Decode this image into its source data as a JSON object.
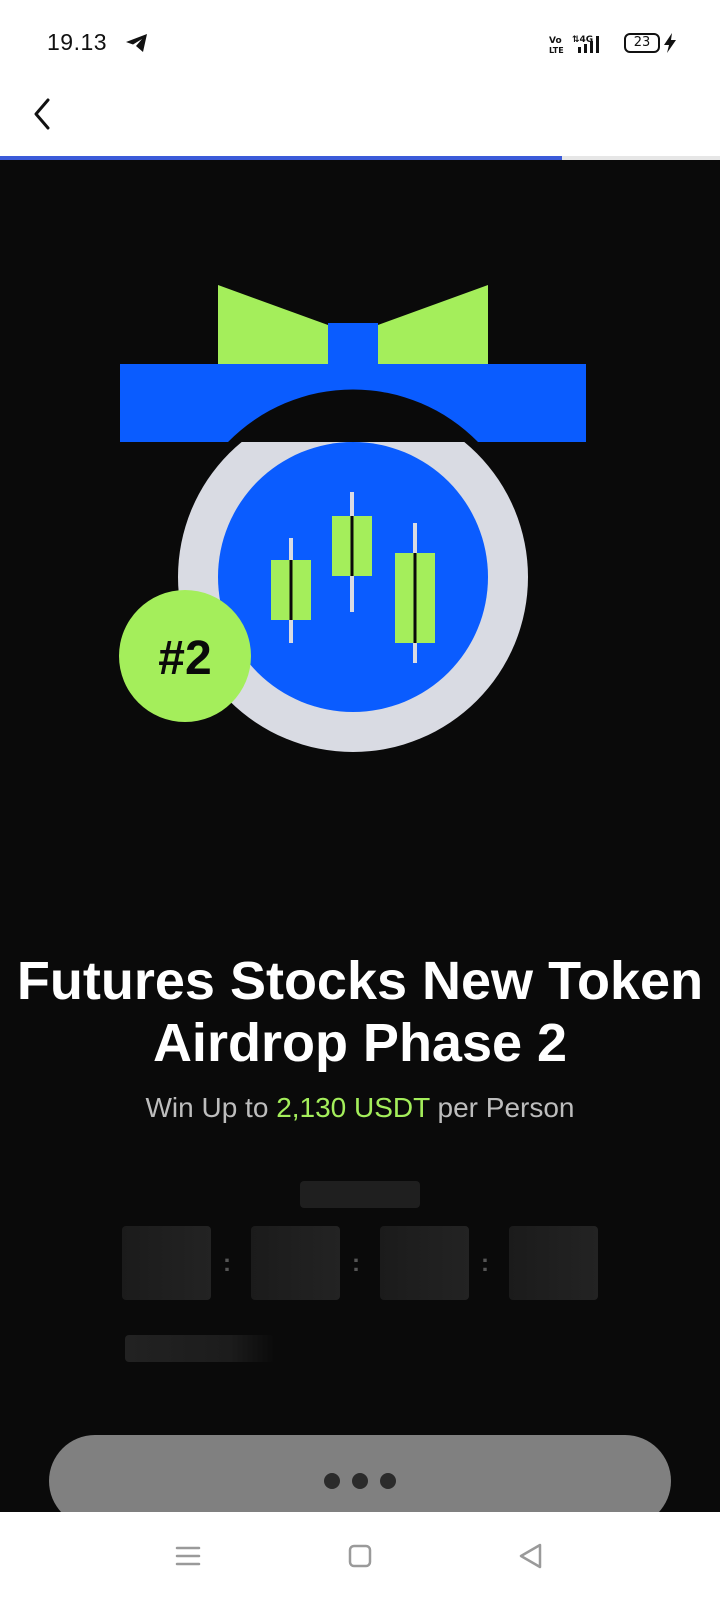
{
  "status_bar": {
    "time": "19.13",
    "battery_level": "23",
    "icons": [
      "telegram-icon",
      "volte-icon",
      "signal-4g-icon",
      "battery-icon",
      "charging-bolt-icon"
    ]
  },
  "header": {
    "back_icon": "chevron-left-icon",
    "progress_fraction": 0.78
  },
  "hero": {
    "badge_text": "#2",
    "colors": {
      "ribbon_blue": "#0a5cff",
      "bow_green": "#a4ee5b",
      "ring_gray": "#d9dbe3",
      "badge_green": "#a4ee5b"
    }
  },
  "promo": {
    "title": "Futures Stocks New Token Airdrop Phase 2",
    "subtitle_prefix": "Win Up to ",
    "subtitle_amount": "2,130 USDT",
    "subtitle_suffix": " per Person"
  },
  "countdown": {
    "separator": ":"
  },
  "nav_bar": {
    "icons": [
      "menu-icon",
      "home-square-icon",
      "back-triangle-icon"
    ]
  },
  "colors": {
    "background": "#0a0a0a",
    "accent_green": "#a4ee5b",
    "button_gray": "#808080"
  }
}
